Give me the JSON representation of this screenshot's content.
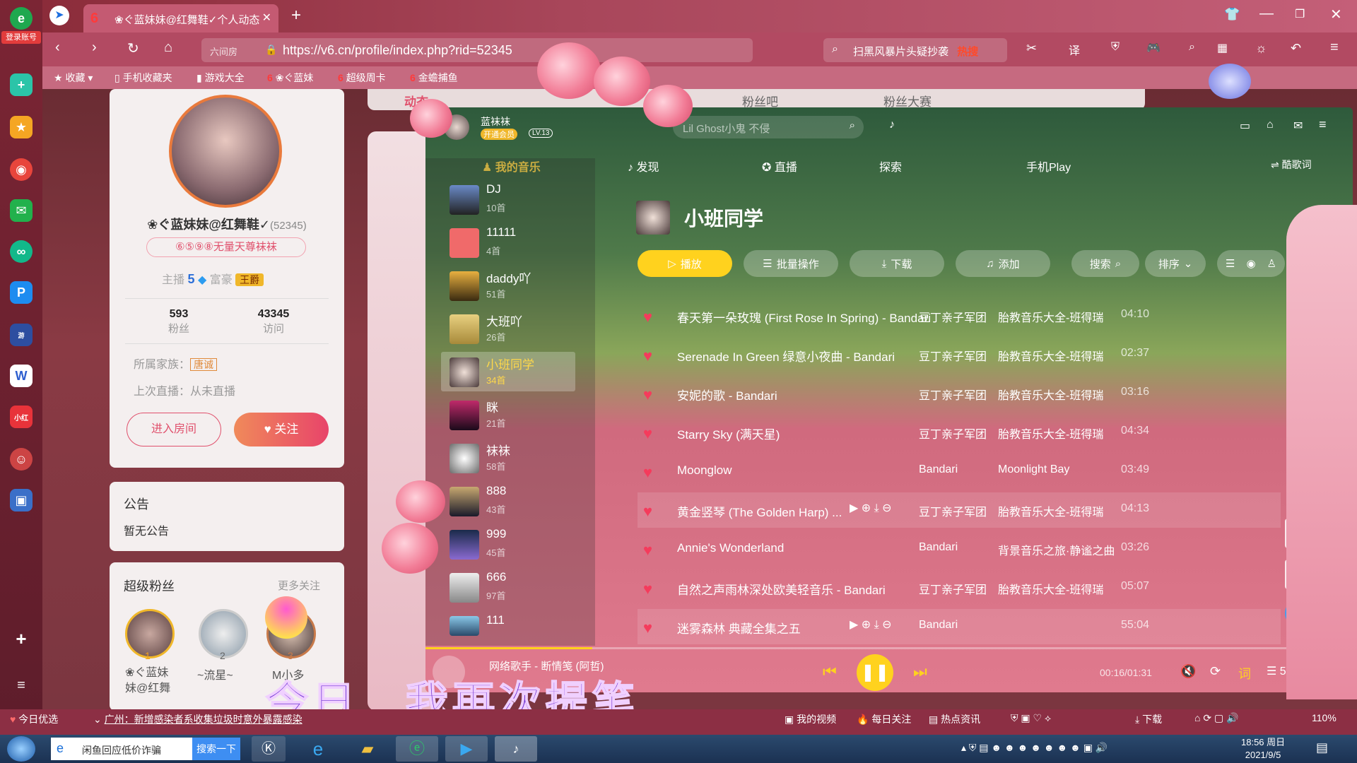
{
  "browser": {
    "tab_title": "❀ぐ蓝妹妹@红舞鞋✓个人动态",
    "url": "https://v6.cn/profile/index.php?rid=52345",
    "url_prefix": "六间房",
    "search_hint": "扫黑风暴片头疑抄袭",
    "search_badge": "热搜",
    "login_label": "登录账号",
    "bookmarks": [
      "收藏",
      "手机收藏夹",
      "游戏大全",
      "❀ぐ蓝妹",
      "超级周卡",
      "金蟾捕鱼"
    ]
  },
  "profile": {
    "name": "❀ぐ蓝妹妹@红舞鞋✓",
    "rid": "(52345)",
    "motto": "⑥⑤⑨⑧无量天尊袜袜",
    "level_label": "主播",
    "level_num": "5",
    "wealth_label": "富豪",
    "wealth_badge": "王爵",
    "fans_count": "593",
    "fans_label": "粉丝",
    "visits_count": "43345",
    "visits_label": "访问",
    "family_label": "所属家族：",
    "family_badge": "唐诚",
    "last_live": "上次直播：从未直播",
    "enter_room": "进入房间",
    "follow": "关注"
  },
  "notice": {
    "title": "公告",
    "content": "暂无公告"
  },
  "superfans": {
    "title": "超级粉丝",
    "more": "更多关注",
    "fans": [
      {
        "rank": "1",
        "name": "❀ぐ蓝妹\n妹@红舞"
      },
      {
        "rank": "2",
        "name": "~流星~"
      },
      {
        "rank": "3",
        "name": "M小多"
      }
    ]
  },
  "bg_tabs": [
    "动态",
    "粉丝吧",
    "粉丝大赛"
  ],
  "player": {
    "user_name": "蓝袜袜",
    "vip_badge": "开通会员",
    "level_badge": "LV.13",
    "search_placeholder": "Lil Ghost小鬼 不侵",
    "nav": [
      "我的音乐",
      "发现",
      "直播",
      "探索",
      "手机Play",
      "酷歌词"
    ],
    "playlists": [
      {
        "name": "DJ",
        "count": "10首"
      },
      {
        "name": "11111",
        "count": "4首"
      },
      {
        "name": "daddy吖",
        "count": "51首"
      },
      {
        "name": "大班吖",
        "count": "26首"
      },
      {
        "name": "小班同学",
        "count": "34首"
      },
      {
        "name": "眯",
        "count": "21首"
      },
      {
        "name": "袜袜",
        "count": "58首"
      },
      {
        "name": "888",
        "count": "43首"
      },
      {
        "name": "999",
        "count": "45首"
      },
      {
        "name": "666",
        "count": "97首"
      },
      {
        "name": "111",
        "count": ""
      }
    ],
    "playlist_title": "小班同学",
    "toolbar": {
      "play": "播放",
      "batch": "批量操作",
      "download": "下载",
      "add": "添加",
      "search": "搜索",
      "sort": "排序"
    },
    "songs": [
      {
        "title": "春天第一朵玫瑰 (First Rose In Spring) - Bandari",
        "artist": "豆丁亲子军团",
        "album": "胎教音乐大全-班得瑞",
        "duration": "04:10"
      },
      {
        "title": "Serenade In Green 绿意小夜曲 - Bandari",
        "artist": "豆丁亲子军团",
        "album": "胎教音乐大全-班得瑞",
        "duration": "02:37"
      },
      {
        "title": "安妮的歌 - Bandari",
        "artist": "豆丁亲子军团",
        "album": "胎教音乐大全-班得瑞",
        "duration": "03:16"
      },
      {
        "title": "Starry Sky (满天星)",
        "artist": "豆丁亲子军团",
        "album": "胎教音乐大全-班得瑞",
        "duration": "04:34"
      },
      {
        "title": "Moonglow",
        "artist": "Bandari",
        "album": "Moonlight Bay",
        "duration": "03:49"
      },
      {
        "title": "黄金竖琴 (The Golden Harp) ...",
        "artist": "豆丁亲子军团",
        "album": "胎教音乐大全-班得瑞",
        "duration": "04:13"
      },
      {
        "title": "Annie's Wonderland",
        "artist": "Bandari",
        "album": "背景音乐之旅·静谧之曲",
        "duration": "03:26"
      },
      {
        "title": "自然之声雨林深处欧美轻音乐 - Bandari",
        "artist": "豆丁亲子军团",
        "album": "胎教音乐大全-班得瑞",
        "duration": "05:07"
      },
      {
        "title": "迷雾森林 典藏全集之五",
        "artist": "Bandari",
        "album": "",
        "duration": "55:04"
      }
    ],
    "now_playing": "网络歌手 - 断情笺 (阿哲)",
    "time": "00:16/01:31",
    "progress": 0.18,
    "lyric_btn": "词",
    "queue_count": "5",
    "lyric_overlay": "今日　我再次提笔"
  },
  "statusbar": {
    "news_label": "今日优选",
    "news": "广州：新增感染者系收集垃圾时意外暴露感染",
    "items": [
      "我的视频",
      "每日关注",
      "热点资讯",
      "下载"
    ],
    "zoom": "110%"
  },
  "taskbar": {
    "search_text": "闲鱼回应低价诈骗",
    "search_btn": "搜索一下",
    "time": "18:56 周日",
    "date": "2021/9/5"
  }
}
